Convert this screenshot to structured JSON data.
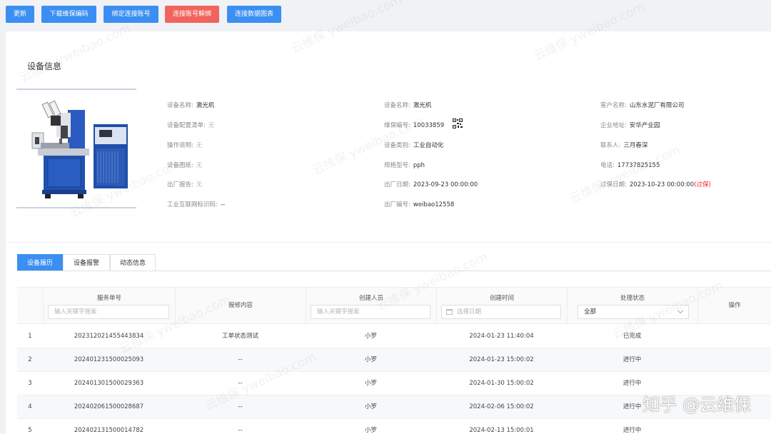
{
  "toolbar": {
    "buttons": [
      {
        "label": "更新",
        "color": "#3b8ff2"
      },
      {
        "label": "下载维保编码",
        "color": "#3b8ff2"
      },
      {
        "label": "绑定连接账号",
        "color": "#3b8ff2"
      },
      {
        "label": "连接账号解绑",
        "color": "#f0645d"
      },
      {
        "label": "连接数据图表",
        "color": "#3b8ff2"
      }
    ]
  },
  "device": {
    "section_title": "设备信息",
    "left": [
      {
        "k": "设备名称:",
        "v": "激光机"
      },
      {
        "k": "设备配置清单:",
        "v": "无"
      },
      {
        "k": "操作说明:",
        "v": "无"
      },
      {
        "k": "设备图纸:",
        "v": "无"
      },
      {
        "k": "出厂报告:",
        "v": "无"
      },
      {
        "k": "工业互联网标识码:",
        "v": "--"
      }
    ],
    "middle": [
      {
        "k": "设备名称:",
        "v": "激光机"
      },
      {
        "k": "维保编号:",
        "v": "10033859"
      },
      {
        "k": "设备类别:",
        "v": "工业自动化"
      },
      {
        "k": "规格型号:",
        "v": "pph"
      },
      {
        "k": "出厂日期:",
        "v": "2023-09-23 00:00:00"
      },
      {
        "k": "出厂编号:",
        "v": "weibao12558"
      }
    ],
    "right": [
      {
        "k": "客户名称:",
        "v": "山东水泥厂有限公司"
      },
      {
        "k": "企业地址:",
        "v": "安华产业园"
      },
      {
        "k": "联系人:",
        "v": "三月春深"
      },
      {
        "k": "电话:",
        "v": "17737825155"
      },
      {
        "k": "过保日期:",
        "v": "2023-10-23 00:00:00",
        "tag": "(过保)"
      }
    ]
  },
  "tabs": [
    "设备履历",
    "设备报警",
    "动态信息"
  ],
  "table": {
    "headers": [
      "服务单号",
      "报修内容",
      "创建人员",
      "创建时间",
      "处理状态",
      "操作"
    ],
    "filters": {
      "order_placeholder": "输入关键字搜索",
      "creator_placeholder": "输入关键字搜索",
      "date_placeholder": "选择日期",
      "status_value": "全部"
    },
    "rows": [
      {
        "idx": "1",
        "order": "202312021455443834",
        "content": "工单状态测试",
        "creator": "小罗",
        "time": "2024-01-23 11:40:04",
        "status": "已完成"
      },
      {
        "idx": "2",
        "order": "202401231500025093",
        "content": "--",
        "creator": "小罗",
        "time": "2024-01-23 15:00:02",
        "status": "进行中"
      },
      {
        "idx": "3",
        "order": "202401301500029363",
        "content": "--",
        "creator": "小罗",
        "time": "2024-01-30 15:00:02",
        "status": "进行中"
      },
      {
        "idx": "4",
        "order": "202402061500028687",
        "content": "--",
        "creator": "小罗",
        "time": "2024-02-06 15:00:02",
        "status": "进行中"
      },
      {
        "idx": "5",
        "order": "202402131500014782",
        "content": "--",
        "creator": "小罗",
        "time": "2024-02-13 15:00:01",
        "status": "进行中"
      }
    ]
  },
  "watermark": "云维保 yweibao.com",
  "brand_watermark": "知乎 @云维保"
}
